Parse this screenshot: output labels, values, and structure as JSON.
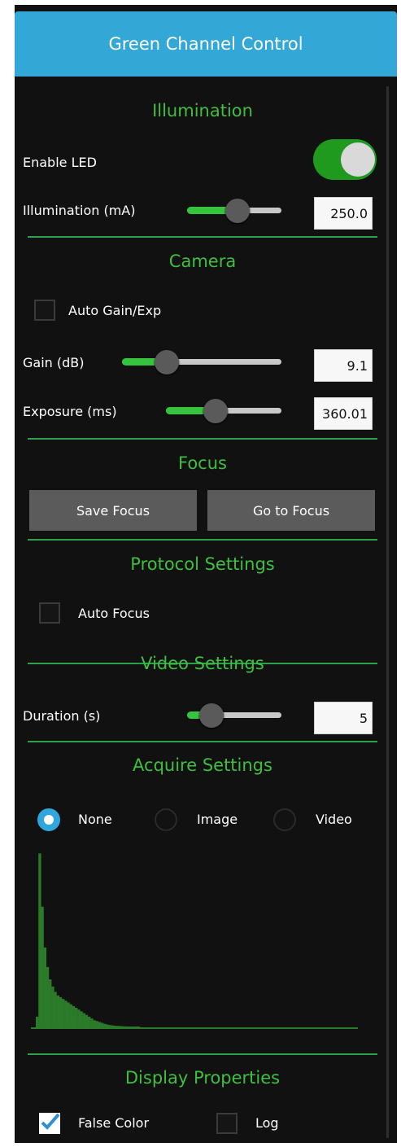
{
  "header": {
    "title": "Green Channel Control"
  },
  "colors": {
    "header_bg": "#33a7d6",
    "accent_green": "#3fbf3f",
    "panel_bg": "#111111",
    "radio_selected": "#2fa7de",
    "histogram": "#2a7a2a"
  },
  "illumination": {
    "title": "Illumination",
    "enable_led_label": "Enable LED",
    "enable_led_on": true,
    "slider_label": "Illumination (mA)",
    "value": "250.0",
    "slider_fraction": 0.55
  },
  "camera": {
    "title": "Camera",
    "auto_gain_label": "Auto Gain/Exp",
    "auto_gain_checked": false,
    "gain_label": "Gain (dB)",
    "gain_value": "9.1",
    "gain_fraction": 0.24,
    "exposure_label": "Exposure (ms)",
    "exposure_value": "360.01",
    "exposure_fraction": 0.41
  },
  "focus": {
    "title": "Focus",
    "save_label": "Save Focus",
    "goto_label": "Go to Focus"
  },
  "protocol": {
    "title": "Protocol Settings",
    "auto_focus_label": "Auto Focus",
    "auto_focus_checked": false
  },
  "video": {
    "title": "Video Settings",
    "duration_label": "Duration (s)",
    "duration_value": "5",
    "duration_fraction": 0.17
  },
  "acquire": {
    "title": "Acquire Settings",
    "options": [
      "None",
      "Image",
      "Video"
    ],
    "selected": "None"
  },
  "histogram": {
    "values": [
      0.06,
      0.98,
      0.68,
      0.45,
      0.34,
      0.27,
      0.23,
      0.2,
      0.18,
      0.17,
      0.16,
      0.15,
      0.14,
      0.13,
      0.12,
      0.11,
      0.1,
      0.09,
      0.08,
      0.07,
      0.06,
      0.05,
      0.04,
      0.035,
      0.03,
      0.025,
      0.02,
      0.016,
      0.013,
      0.011,
      0.009,
      0.008,
      0.007,
      0.006,
      0.005,
      0.005,
      0.004,
      0.004,
      0.003,
      0.003
    ]
  },
  "display": {
    "title": "Display Properties",
    "false_color_label": "False Color",
    "false_color_checked": true,
    "log_label": "Log",
    "log_checked": false
  }
}
